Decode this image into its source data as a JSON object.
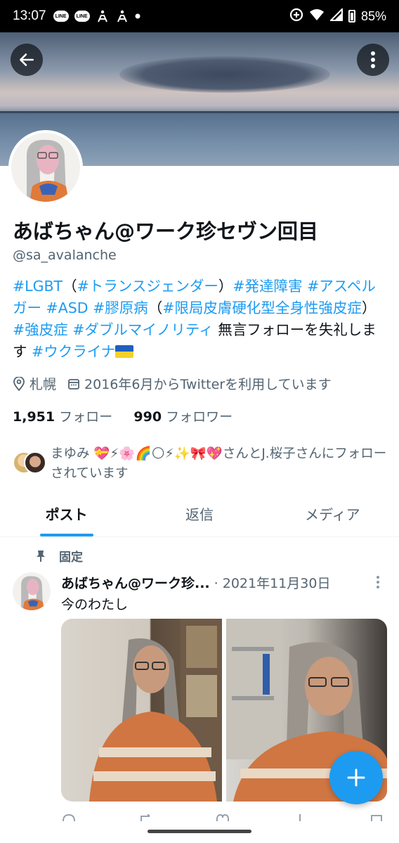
{
  "status_bar": {
    "time": "13:07",
    "line_badge": "LINE",
    "battery": "85%"
  },
  "profile": {
    "display_name": "あばちゃん@ワーク珍セヴン回目",
    "handle": "@sa_avalanche",
    "bio_segments": [
      {
        "text": "#LGBT",
        "tag": true
      },
      {
        "text": "（",
        "tag": false
      },
      {
        "text": "#トランスジェンダー",
        "tag": true
      },
      {
        "text": "）",
        "tag": false
      },
      {
        "text": "#発達障害",
        "tag": true
      },
      {
        "text": " ",
        "tag": false
      },
      {
        "text": "#アスペルガー",
        "tag": true
      },
      {
        "text": " ",
        "tag": false
      },
      {
        "text": "#ASD",
        "tag": true
      },
      {
        "text": " ",
        "tag": false
      },
      {
        "text": "#膠原病",
        "tag": true
      },
      {
        "text": "（",
        "tag": false
      },
      {
        "text": "#限局皮膚硬化型全身性強皮症",
        "tag": true
      },
      {
        "text": "）",
        "tag": false
      },
      {
        "text": "#強皮症",
        "tag": true
      },
      {
        "text": " ",
        "tag": false
      },
      {
        "text": "#ダブルマイノリティ",
        "tag": true
      },
      {
        "text": " 無言フォローを失礼します ",
        "tag": false
      },
      {
        "text": "#ウクライナ",
        "tag": true
      }
    ],
    "location": "札幌",
    "joined": "2016年6月からTwitterを利用しています",
    "following_count": "1,951",
    "following_label": "フォロー",
    "followers_count": "990",
    "followers_label": "フォロワー",
    "followed_by_text": "まゆみ 💝⚡🌸🌈🌕⚡✨🎀💖さんとJ.桜子さんにフォローされています"
  },
  "tabs": [
    {
      "label": "ポスト",
      "active": true
    },
    {
      "label": "返信",
      "active": false
    },
    {
      "label": "メディア",
      "active": false
    }
  ],
  "post": {
    "pinned_label": "固定",
    "author": "あばちゃん@ワーク珍...",
    "date": "· 2021年11月30日",
    "text": "今のわたし"
  },
  "colors": {
    "accent": "#1d9bf0",
    "secondary_text": "#536471"
  },
  "icons": [
    "back-arrow-icon",
    "more-vertical-icon",
    "location-pin-icon",
    "calendar-icon",
    "pin-icon",
    "plus-icon"
  ]
}
